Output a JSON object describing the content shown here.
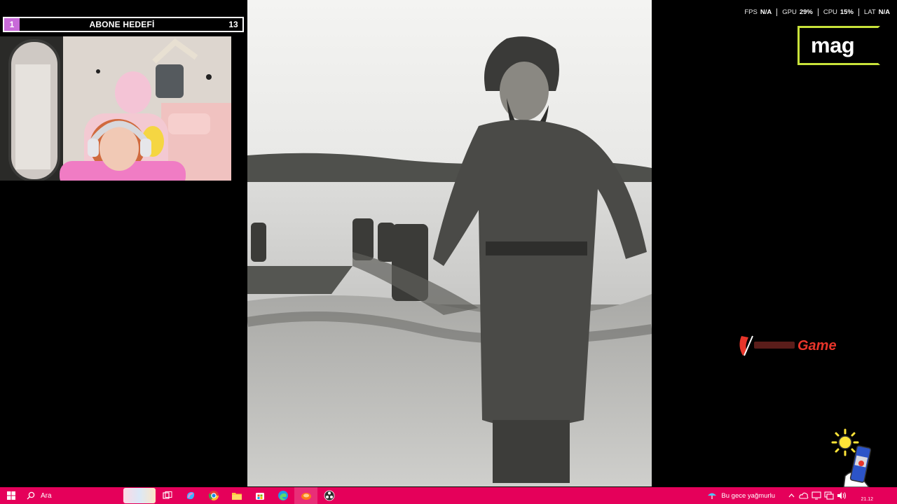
{
  "goal": {
    "title": "ABONE HEDEFİ",
    "current": "1",
    "target": "13"
  },
  "stats": [
    {
      "label": "FPS",
      "value": "N/A"
    },
    {
      "label": "GPU",
      "value": "29%"
    },
    {
      "label": "CPU",
      "value": "15%"
    },
    {
      "label": "LAT",
      "value": "N/A"
    }
  ],
  "logo": {
    "text": "mag",
    "accent": "#c8e23a"
  },
  "sponsor": {
    "text": "Game"
  },
  "taskbar": {
    "search_placeholder": "Ara",
    "weather_text": "Bu gece yağmurlu",
    "clock": "21.12",
    "color": "#e5005a"
  },
  "colors": {
    "goal_fill": "#c86ad8",
    "sponsor": "#e8352a"
  }
}
